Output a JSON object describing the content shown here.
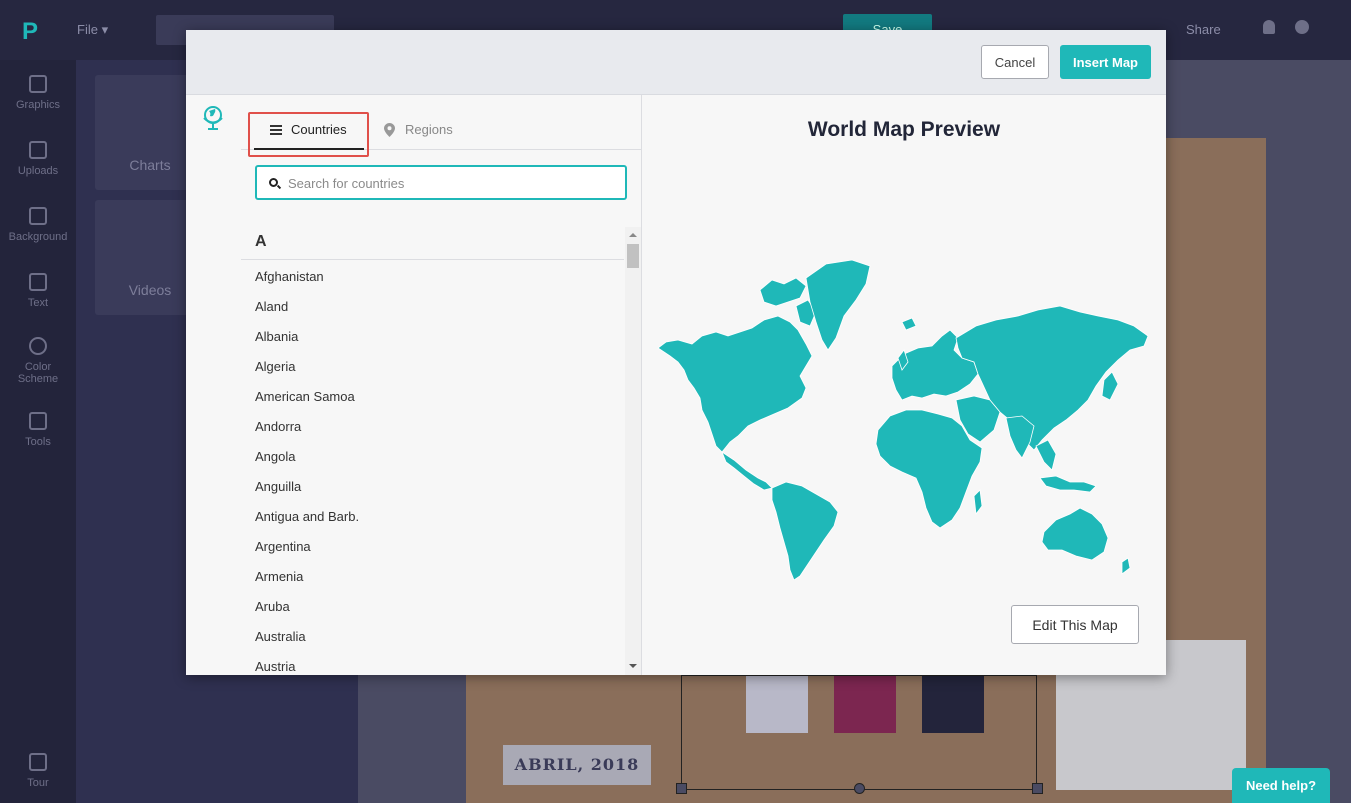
{
  "app": {
    "file_menu": "File",
    "save_label": "Save",
    "share_label": "Share",
    "help_button": "Need help?"
  },
  "sidebar": {
    "items": [
      {
        "label": "Graphics",
        "icon": "image-icon"
      },
      {
        "label": "Uploads",
        "icon": "upload-icon"
      },
      {
        "label": "Background",
        "icon": "background-icon"
      },
      {
        "label": "Text",
        "icon": "text-icon"
      },
      {
        "label": "Color Scheme",
        "icon": "palette-icon"
      },
      {
        "label": "Tools",
        "icon": "toolbox-icon"
      },
      {
        "label": "Tour",
        "icon": "tour-icon"
      }
    ]
  },
  "panel": {
    "cards": [
      "Charts",
      "Videos"
    ]
  },
  "canvas": {
    "date_label": "ABRIL, 2018"
  },
  "modal": {
    "cancel_label": "Cancel",
    "insert_label": "Insert Map",
    "tabs": {
      "countries": "Countries",
      "regions": "Regions",
      "active": "Countries"
    },
    "search": {
      "placeholder": "Search for countries",
      "value": ""
    },
    "letter": "A",
    "countries": [
      "Afghanistan",
      "Aland",
      "Albania",
      "Algeria",
      "American Samoa",
      "Andorra",
      "Angola",
      "Anguilla",
      "Antigua and Barb.",
      "Argentina",
      "Armenia",
      "Aruba",
      "Australia",
      "Austria"
    ],
    "preview_title": "World Map Preview",
    "edit_label": "Edit This Map",
    "map_color": "#1fb8b8"
  },
  "colors": {
    "accent": "#1fb8b8",
    "highlight_box": "#e0504a"
  }
}
